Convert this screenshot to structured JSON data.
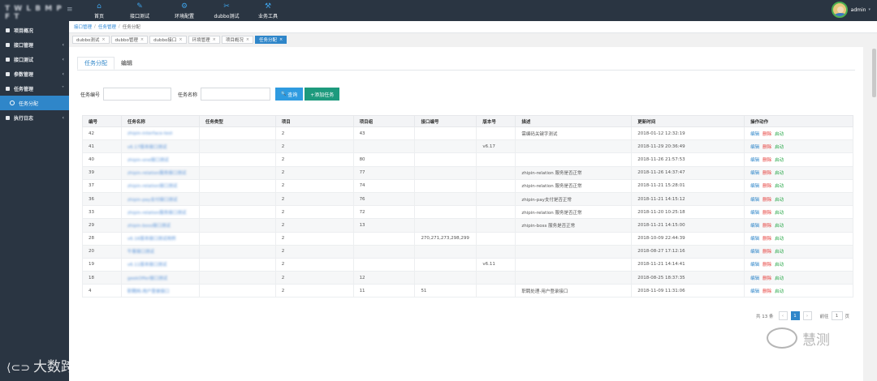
{
  "app": {
    "logo": "T W L B M P F T"
  },
  "topnav": [
    {
      "label": "首页",
      "icon": "home-icon",
      "glyph": "⌂"
    },
    {
      "label": "接口测试",
      "icon": "edit-icon",
      "glyph": "✎"
    },
    {
      "label": "环境配置",
      "icon": "gear-icon",
      "glyph": "⚙"
    },
    {
      "label": "dubbo测试",
      "icon": "tools-icon",
      "glyph": "✂"
    },
    {
      "label": "业务工具",
      "icon": "wrench-icon",
      "glyph": "⚒"
    }
  ],
  "user": {
    "name": "admin"
  },
  "sidebar": {
    "items": [
      {
        "label": "项目概况"
      },
      {
        "label": "接口管理"
      },
      {
        "label": "接口测试"
      },
      {
        "label": "参数管理"
      },
      {
        "label": "任务管理"
      },
      {
        "label": "任务分配"
      },
      {
        "label": "执行日志"
      }
    ]
  },
  "breadcrumb": {
    "home": "接口管理",
    "parent": "任务管理",
    "current": "任务分配"
  },
  "page_tabs": [
    {
      "label": "dubbo测试"
    },
    {
      "label": "dubbo管理"
    },
    {
      "label": "dubbo接口"
    },
    {
      "label": "环境管理"
    },
    {
      "label": "项目概况"
    },
    {
      "label": "任务分配"
    }
  ],
  "subtabs": {
    "assign": "任务分配",
    "edit": "编辑"
  },
  "search": {
    "id_label": "任务编号",
    "name_label": "任务名称",
    "query_button": "查询",
    "add_button": "+添加任务",
    "query_glyph": "🔍"
  },
  "table": {
    "headers": [
      "编号",
      "任务名称",
      "任务类型",
      "项目",
      "项目组",
      "接口编号",
      "版本号",
      "描述",
      "更新时间",
      "操作动作"
    ],
    "actions": {
      "edit": "编辑",
      "delete": "删除",
      "start": "启动"
    },
    "rows": [
      {
        "id": "42",
        "name": "zhipin-interface-test",
        "type": "",
        "project": "2",
        "group": "43",
        "api": "",
        "version": "",
        "desc": "需编码关键字测试",
        "time": "2018-01-12 12:32:19"
      },
      {
        "id": "41",
        "name": "v6.17版本接口测试",
        "type": "",
        "project": "2",
        "group": "",
        "api": "",
        "version": "v6.17",
        "desc": "",
        "time": "2018-11-29 20:36:49"
      },
      {
        "id": "40",
        "name": "zhipin-one接口测试",
        "type": "",
        "project": "2",
        "group": "80",
        "api": "",
        "version": "",
        "desc": "",
        "time": "2018-11-26 21:57:53"
      },
      {
        "id": "39",
        "name": "zhipin-relation服务接口测试",
        "type": "",
        "project": "2",
        "group": "77",
        "api": "",
        "version": "",
        "desc": "zhipin-relation 服务是否正常",
        "time": "2018-11-26 14:37:47"
      },
      {
        "id": "37",
        "name": "zhipin-relation接口测试",
        "type": "",
        "project": "2",
        "group": "74",
        "api": "",
        "version": "",
        "desc": "zhipin-relation 服务是否正常",
        "time": "2018-11-21 15:28:01"
      },
      {
        "id": "36",
        "name": "zhipin-pay支付接口测试",
        "type": "",
        "project": "2",
        "group": "76",
        "api": "",
        "version": "",
        "desc": "zhipin-pay支付是否正常",
        "time": "2018-11-21 14:15:12"
      },
      {
        "id": "33",
        "name": "zhipin-relation服务接口测试",
        "type": "",
        "project": "2",
        "group": "72",
        "api": "",
        "version": "",
        "desc": "zhipin-relation 服务是否正常",
        "time": "2018-11-20 10:25:18"
      },
      {
        "id": "29",
        "name": "zhipin-boss接口测试",
        "type": "",
        "project": "2",
        "group": "13",
        "api": "",
        "version": "",
        "desc": "zhipin-boss 服务是否正常",
        "time": "2018-11-21 14:15:00"
      },
      {
        "id": "28",
        "name": "v6.16版本接口测试用例",
        "type": "",
        "project": "2",
        "group": "",
        "api": "270,271,273,298,299",
        "version": "",
        "desc": "",
        "time": "2018-10-09 22:44:39"
      },
      {
        "id": "20",
        "name": "牛客接口测试",
        "type": "",
        "project": "2",
        "group": "",
        "api": "",
        "version": "",
        "desc": "",
        "time": "2018-08-27 17:12:16"
      },
      {
        "id": "19",
        "name": "v6.11版本接口测试",
        "type": "",
        "project": "2",
        "group": "",
        "api": "",
        "version": "v6.11",
        "desc": "",
        "time": "2018-11-21 14:14:41"
      },
      {
        "id": "18",
        "name": "geekOffer接口测试",
        "type": "",
        "project": "2",
        "group": "12",
        "api": "",
        "version": "",
        "desc": "",
        "time": "2018-08-25 18:37:35"
      },
      {
        "id": "4",
        "name": "职聘网-用户登录接口",
        "type": "",
        "project": "2",
        "group": "11",
        "api": "51",
        "version": "",
        "desc": "职聘处理-用户登录接口",
        "time": "2018-11-09 11:31:06"
      }
    ]
  },
  "pagination": {
    "total": "共 13 条",
    "prev": "‹",
    "page": "1",
    "next": "›",
    "goto_label": "前往",
    "goto_value": "1",
    "page_unit": "页"
  },
  "watermarks": {
    "left": "大数跨境",
    "right": "慧测"
  }
}
